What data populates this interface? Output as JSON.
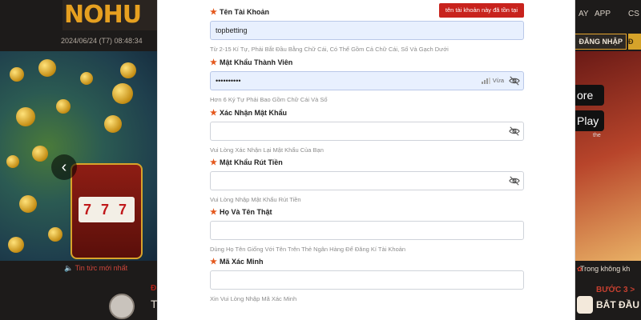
{
  "background": {
    "logo_text": "NOHU",
    "datetime": "2024/06/24 (T7) 08:48:34",
    "latest_news_label": "Tin tức mới nhất",
    "nav_items": [
      "AY",
      "APP",
      "CS"
    ],
    "login_button": "ĐĂNG NHẬP",
    "register_button": "Đ",
    "store_labels": {
      "the": "the",
      "store": "ore",
      "play": "Play"
    },
    "ticker_text": "Trong không kh",
    "step_label": "BƯỚC 3 >",
    "start_label": "BẮT ĐẦU"
  },
  "form": {
    "username": {
      "label": "Tên Tài Khoản",
      "value": "topbetting",
      "error": "tên tài khoản này đã tồn tại",
      "hint": "Từ 2-15 Kí Tự, Phải Bắt Đầu Bằng Chữ Cái, Có Thể Gồm Cả Chữ Cái, Số Và Gạch Dưới"
    },
    "password": {
      "label": "Mật Khẩu Thành Viên",
      "value": "••••••••••",
      "strength": "Vừa",
      "hint": "Hơn 6 Ký Tự Phải Bao Gồm Chữ Cái Và Số"
    },
    "confirm_password": {
      "label": "Xác Nhận Mật Khẩu",
      "value": "",
      "hint": "Vui Lòng Xác Nhận Lại Mật Khẩu Của Bạn"
    },
    "withdraw_password": {
      "label": "Mật Khẩu Rút Tiền",
      "value": "",
      "hint": "Vui Lòng Nhập Mật Khẩu Rút Tiền"
    },
    "full_name": {
      "label": "Họ Và Tên Thật",
      "value": "",
      "hint": "Dùng Họ Tên Giống Với Tên Trên Thẻ Ngân Hàng Để Đăng Kí Tài Khoản"
    },
    "captcha": {
      "label": "Mã Xác Minh",
      "value": "",
      "hint": "Xin Vui Lòng Nhập Mã Xác Minh"
    }
  },
  "colors": {
    "required_star": "#e4561a",
    "error_bg": "#c8231d",
    "autofill_bg": "#e8f0fe"
  }
}
